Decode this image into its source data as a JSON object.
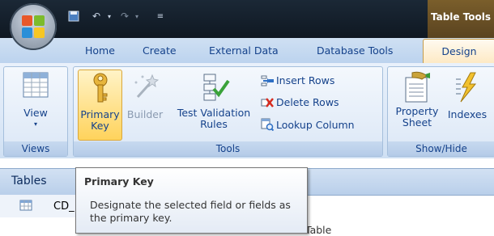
{
  "title_bar": {
    "contextual_tab_label": "Table Tools",
    "qat_icons": [
      "save-icon",
      "undo-icon",
      "redo-icon",
      "customize-qat-icon"
    ]
  },
  "tabs": [
    "Home",
    "Create",
    "External Data",
    "Database Tools",
    "Design"
  ],
  "ribbon": {
    "views": {
      "button": "View",
      "group_label": "Views"
    },
    "tools": {
      "primary_key": [
        "Primary",
        "Key"
      ],
      "builder": "Builder",
      "test_validation": [
        "Test Validation",
        "Rules"
      ],
      "insert_rows": "Insert Rows",
      "delete_rows": "Delete Rows",
      "lookup_column": "Lookup Column",
      "group_label": "Tools"
    },
    "show_hide": {
      "property_sheet": [
        "Property",
        "Sheet"
      ],
      "indexes": "Indexes",
      "group_label": "Show/Hide"
    }
  },
  "nav_pane": {
    "title": "Tables",
    "item": "CD_"
  },
  "background_text": "Table",
  "tooltip": {
    "title": "Primary Key",
    "body": "Designate the selected field or fields as the primary key."
  },
  "colors": {
    "accent_text": "#15428b",
    "highlight": "#ffd35c",
    "contextual": "#7a5e2b"
  }
}
